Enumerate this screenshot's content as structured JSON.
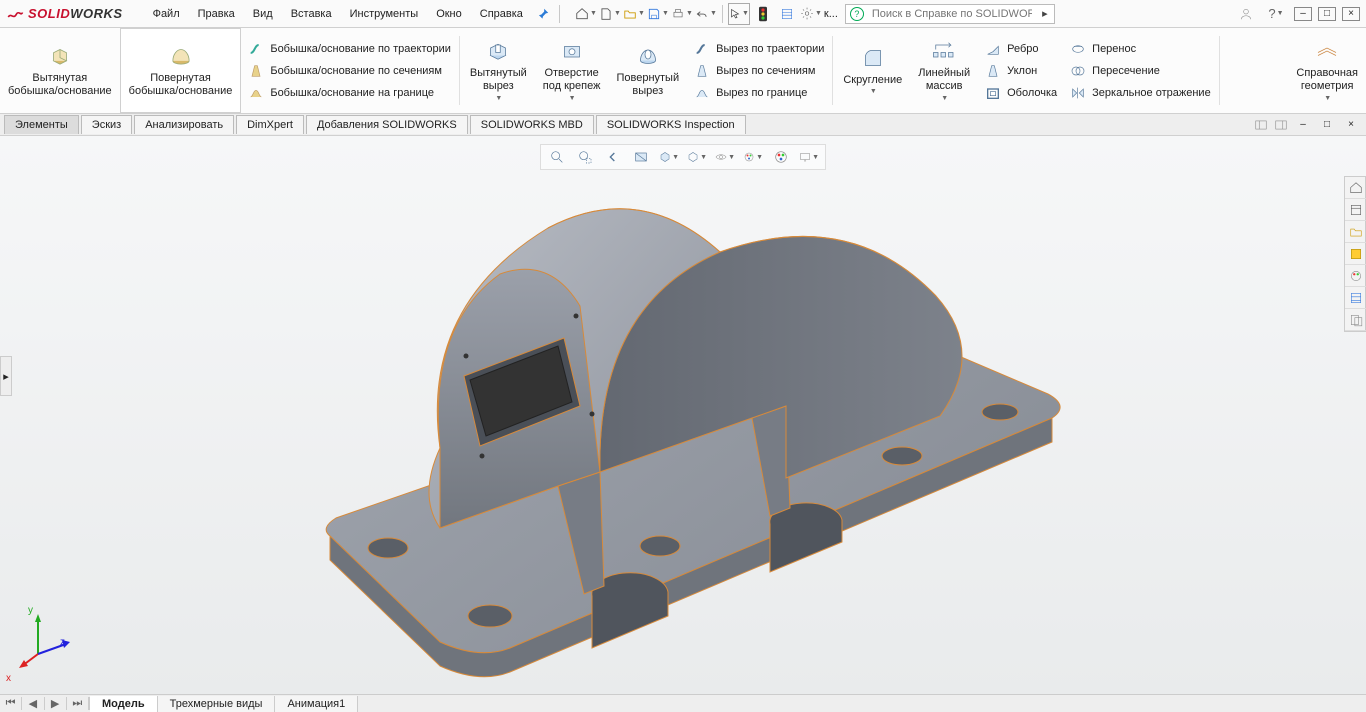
{
  "app": {
    "name_solid": "SOLID",
    "name_works": "WORKS"
  },
  "menu": [
    "Файл",
    "Правка",
    "Вид",
    "Вставка",
    "Инструменты",
    "Окно",
    "Справка"
  ],
  "quick_extra": "к...",
  "search": {
    "placeholder": "Поиск в Справке по SOLIDWOR"
  },
  "ribbon": {
    "extrude_boss": {
      "l1": "Вытянутая",
      "l2": "бобышка/основание"
    },
    "revolve_boss": {
      "l1": "Повернутая",
      "l2": "бобышка/основание"
    },
    "sweep_boss": "Бобышка/основание по траектории",
    "loft_boss": "Бобышка/основание по сечениям",
    "boundary_boss": "Бобышка/основание на границе",
    "extrude_cut": {
      "l1": "Вытянутый",
      "l2": "вырез"
    },
    "hole": {
      "l1": "Отверстие",
      "l2": "под крепеж"
    },
    "revolve_cut": {
      "l1": "Повернутый",
      "l2": "вырез"
    },
    "sweep_cut": "Вырез по траектории",
    "loft_cut": "Вырез по сечениям",
    "boundary_cut": "Вырез по границе",
    "fillet": "Скругление",
    "pattern": {
      "l1": "Линейный",
      "l2": "массив"
    },
    "rib": "Ребро",
    "draft": "Уклон",
    "shell": "Оболочка",
    "wrap": "Перенос",
    "intersect": "Пересечение",
    "mirror": "Зеркальное отражение",
    "refgeo": {
      "l1": "Справочная",
      "l2": "геометрия"
    }
  },
  "cmdtabs": [
    "Элементы",
    "Эскиз",
    "Анализировать",
    "DimXpert",
    "Добавления SOLIDWORKS",
    "SOLIDWORKS MBD",
    "SOLIDWORKS Inspection"
  ],
  "triad": {
    "x": "x",
    "y": "y",
    "z": "z"
  },
  "bottom": {
    "tabs": [
      "Модель",
      "Трехмерные виды",
      "Анимация1"
    ]
  }
}
